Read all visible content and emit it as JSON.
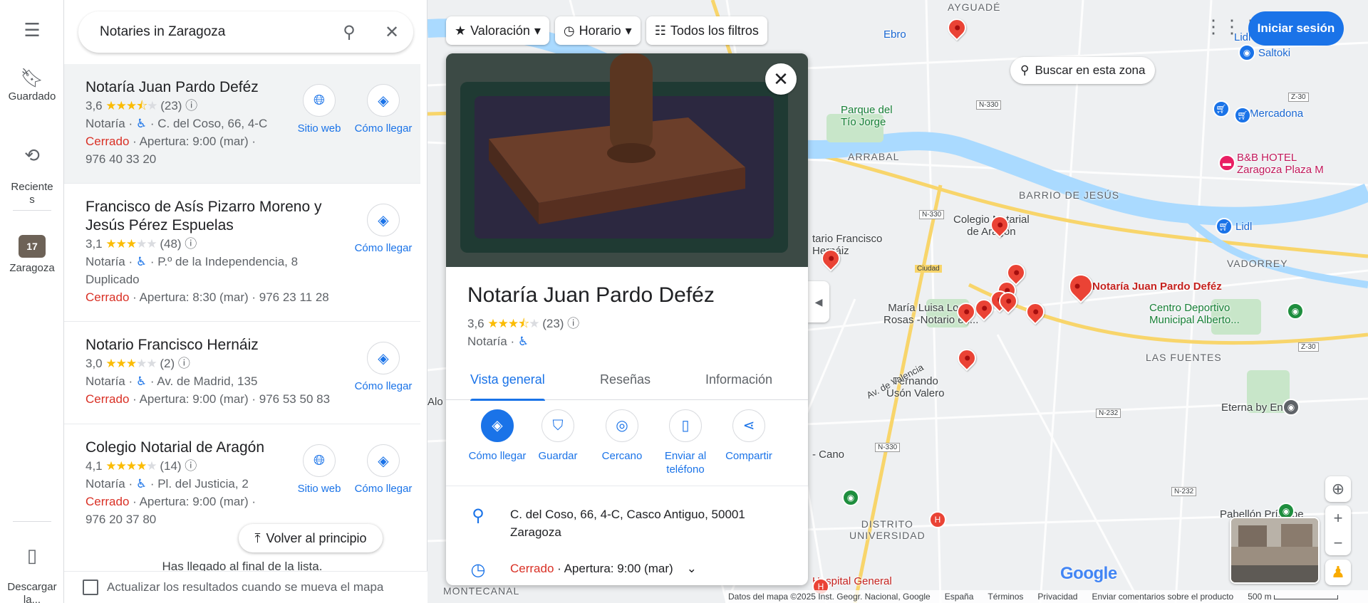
{
  "search": {
    "value": "Notaries in Zaragoza"
  },
  "rail": {
    "saved": "Guardado",
    "recent": "Reciente\ns",
    "city_count": "17",
    "city": "Zaragoza",
    "download": "Descargar\nla..."
  },
  "results": [
    {
      "name": "Notaría Juan Pardo Deféz",
      "rating": "3,6",
      "stars": 3.6,
      "reviews": "(23)",
      "category": "Notaría",
      "address": "C. del Coso, 66, 4-C",
      "status": "Cerrado",
      "hours": "Apertura: 9:00 (mar)",
      "phone": "976 40 33 20",
      "actions": [
        "Sitio web",
        "Cómo llegar"
      ]
    },
    {
      "name": "Francisco de Asís Pizarro Moreno y Jesús Pérez Espuelas",
      "rating": "3,1",
      "stars": 3.1,
      "reviews": "(48)",
      "category": "Notaría",
      "address": "P.º de la Independencia, 8 Duplicado",
      "status": "Cerrado",
      "hours": "Apertura: 8:30 (mar)",
      "phone": "976 23 11 28",
      "actions": [
        "Cómo llegar"
      ]
    },
    {
      "name": "Notario Francisco Hernáiz",
      "rating": "3,0",
      "stars": 3.0,
      "reviews": "(2)",
      "category": "Notaría",
      "address": "Av. de Madrid, 135",
      "status": "Cerrado",
      "hours": "Apertura: 9:00 (mar)",
      "phone": "976 53 50 83",
      "actions": [
        "Cómo llegar"
      ]
    },
    {
      "name": "Colegio Notarial de Aragón",
      "rating": "4,1",
      "stars": 4.1,
      "reviews": "(14)",
      "category": "Notaría",
      "address": "Pl. del Justicia, 2",
      "status": "Cerrado",
      "hours": "Apertura: 9:00 (mar)",
      "phone": "976 20 37 80",
      "actions": [
        "Sitio web",
        "Cómo llegar"
      ]
    }
  ],
  "back_to_top": "Volver al principio",
  "end_of_list": "Has llegado al final de la lista.",
  "update_results": "Actualizar los resultados cuando se mueva el mapa",
  "chips": [
    "Valoración",
    "Horario",
    "Todos los filtros"
  ],
  "signin": "Iniciar sesión",
  "search_area": "Buscar en esta zona",
  "card": {
    "title": "Notaría Juan Pardo Deféz",
    "rating": "3,6",
    "stars": 3.6,
    "reviews": "(23)",
    "category": "Notaría",
    "tabs": [
      "Vista general",
      "Reseñas",
      "Información"
    ],
    "actions": [
      "Cómo llegar",
      "Guardar",
      "Cercano",
      "Enviar al\nteléfono",
      "Compartir"
    ],
    "address": "C. del Coso, 66, 4-C, Casco Antiguo, 50001 Zaragoza",
    "status": "Cerrado",
    "hours": "Apertura: 9:00 (mar)"
  },
  "map_labels": {
    "selected_pin": "Notaría Juan Pardo Deféz",
    "colegio": "Colegio Notarial\nde Aragón",
    "maria": "María Luisa Loren\nRosas -Notario en...",
    "fernando": "Fernando\nUsón Valero",
    "francisco": "tario Francisco\nHernáiz",
    "centro": "Centro Deportivo\nMunicipal Alberto...",
    "eterna": "Eterna by Envie",
    "hospital": "Hospital General",
    "pabellon": "Pabellón Príncipe",
    "bb": "B&B HOTEL\nZaragoza Plaza M",
    "mercadona": "Mercadona",
    "lidl1": "Lidl",
    "lidl2": "Lidl",
    "saltoki": "Saltoki",
    "parque": "Parque del\nTío Jorge",
    "arrabal": "ARRABAL",
    "barrio": "BARRIO DE JESÚS",
    "vadorrey": "VADORREY",
    "fuentes": "LAS FUENTES",
    "distrito": "DISTRITO\nUNIVERSIDAD",
    "montecanal": "MONTECANAL",
    "aygude": "AYGUADÉ",
    "ebro": "Ebro",
    "ciudad": "Ciudad",
    "avvalencia": "Av. de Valencia",
    "cano": "- Cano",
    "alo": "Alo"
  },
  "road_badges": [
    "N-330",
    "N-330",
    "N-330",
    "N-232",
    "N-232",
    "Z-30",
    "Z-30"
  ],
  "footer": {
    "data": "Datos del mapa ©2025 Inst. Geogr. Nacional, Google",
    "country": "España",
    "terms": "Términos",
    "privacy": "Privacidad",
    "feedback": "Enviar comentarios sobre el producto",
    "scale": "500 m"
  },
  "logo": "Google",
  "colors": {
    "accent": "#1a73e8",
    "closed": "#d93025",
    "pin": "#ea4335",
    "river": "#aadaff",
    "park": "#c8e6c9"
  }
}
